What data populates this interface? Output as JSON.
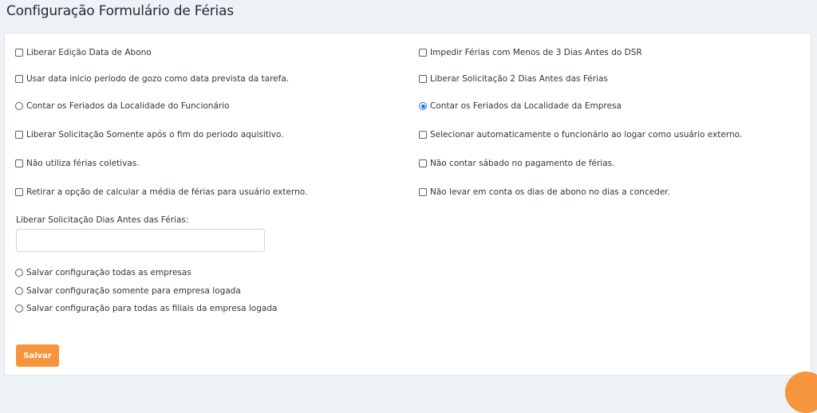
{
  "page": {
    "title": "Configuração Formulário de Férias"
  },
  "form": {
    "left_options": [
      {
        "label": "Liberar Edição Data de Abono",
        "type": "checkbox",
        "checked": false
      },
      {
        "label": "Usar data inicio período de gozo como data prevista da tarefa.",
        "type": "checkbox",
        "checked": false
      },
      {
        "label": "Contar os Feriados da Localidade do Funcionário",
        "type": "radio",
        "checked": false
      },
      {
        "label": "Liberar Solicitação Somente após o fim do periodo aquisitivo.",
        "type": "checkbox",
        "checked": false
      },
      {
        "label": "Não utiliza férias coletivas.",
        "type": "checkbox",
        "checked": false
      },
      {
        "label": "Retirar a opção de calcular a média de férias para usuário externo.",
        "type": "checkbox",
        "checked": false
      }
    ],
    "right_options": [
      {
        "label": "Impedir Férias com Menos de 3 Dias Antes do DSR",
        "type": "checkbox",
        "checked": false
      },
      {
        "label": "Liberar Solicitação 2 Dias Antes das Férias",
        "type": "checkbox",
        "checked": false
      },
      {
        "label": "Contar os Feriados da Localidade da Empresa",
        "type": "radio",
        "checked": true
      },
      {
        "label": "Selecionar automaticamente o funcionário ao logar como usuário externo.",
        "type": "checkbox",
        "checked": false
      },
      {
        "label": "Não contar sábado no pagamento de férias.",
        "type": "checkbox",
        "checked": false
      },
      {
        "label": "Não levar em conta os dias de abono no dias a conceder.",
        "type": "checkbox",
        "checked": false
      }
    ],
    "days_before_label": "Liberar Solicitação Dias Antes das Férias:",
    "days_before_value": "",
    "scope_options": [
      {
        "label": "Salvar configuração todas as empresas",
        "checked": false
      },
      {
        "label": "Salvar configuração somente para empresa logada",
        "checked": false
      },
      {
        "label": "Salvar configuração para todas as filiais da empresa logada",
        "checked": false
      }
    ],
    "save_label": "Salvar"
  },
  "colors": {
    "accent": "#f7943e",
    "radio_selected": "#1a73e8",
    "background": "#eef1f6"
  }
}
